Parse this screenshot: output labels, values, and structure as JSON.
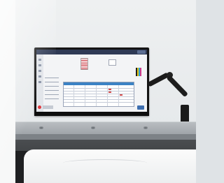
{
  "scene": {
    "description_tags": [
      "monitor-icon",
      "monitor-arm-icon",
      "printer-machine-icon",
      "fabric-icon"
    ]
  },
  "colors": {
    "wall": "#eceeef",
    "monitor_bezel": "#141414",
    "screen_bg": "#f3f4f6",
    "topbar": "#2f3a55",
    "table_header": "#3b82c4",
    "stop_button": "#e0393e",
    "action_button": "#3e6fb0",
    "machine_top": "#b9bdc1",
    "fabric": "#fbfbfb"
  }
}
